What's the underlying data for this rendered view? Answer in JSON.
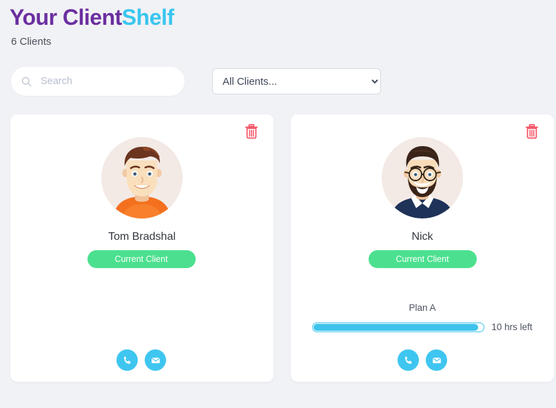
{
  "header": {
    "title_primary": "Your Client",
    "title_accent": "Shelf",
    "count_label": "6 Clients",
    "title_primary_color": "#6b2fa0",
    "title_accent_color": "#38c6ef"
  },
  "controls": {
    "search": {
      "placeholder": "Search",
      "value": "",
      "icon": "search-icon"
    },
    "filter": {
      "selected": "All Clients...",
      "options": [
        "All Clients..."
      ],
      "icon": "chevron-down-icon"
    }
  },
  "cards": [
    {
      "name": "Tom Bradshal",
      "status": "Current Client",
      "status_color": "#4be08f",
      "delete_icon": "trash-icon",
      "has_plan": false,
      "plan": null,
      "progress_text": null,
      "progress_percent": null,
      "actions": [
        {
          "icon": "phone-icon",
          "label": "Call"
        },
        {
          "icon": "envelope-icon",
          "label": "Email"
        }
      ]
    },
    {
      "name": "Nick",
      "status": "Current Client",
      "status_color": "#4be08f",
      "delete_icon": "trash-icon",
      "has_plan": true,
      "plan": "Plan A",
      "progress_text": "10 hrs left",
      "progress_percent": 97,
      "actions": [
        {
          "icon": "phone-icon",
          "label": "Call"
        },
        {
          "icon": "envelope-icon",
          "label": "Email"
        }
      ]
    }
  ],
  "theme": {
    "background": "#f1f2f5",
    "card_background": "#ffffff",
    "accent": "#3fc6f0",
    "danger": "#f4586a"
  }
}
